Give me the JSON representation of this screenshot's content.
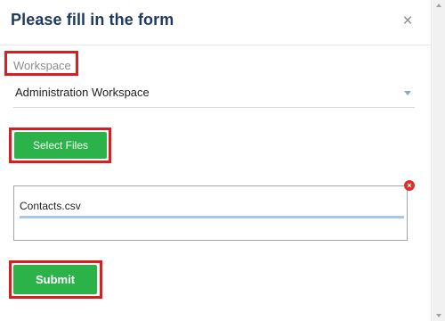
{
  "dialog": {
    "title": "Please fill in the form",
    "close_label": "×"
  },
  "workspace": {
    "label": "Workspace",
    "selected": "Administration Workspace"
  },
  "select_files": {
    "label": "Select Files"
  },
  "upload": {
    "file_name": "Contacts.csv",
    "progress": 1.0,
    "remove_label": "×"
  },
  "submit": {
    "label": "Submit"
  },
  "colors": {
    "title": "#1f3a5f",
    "button_green": "#2bb34a",
    "highlight_red": "#d42020",
    "remove_red": "#d83030",
    "progress": "#a9c9e8"
  },
  "icons": {
    "close": "close-icon",
    "dropdown": "chevron-down-icon",
    "remove": "remove-file-icon"
  }
}
